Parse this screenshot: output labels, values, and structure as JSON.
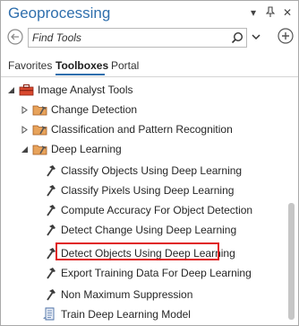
{
  "header": {
    "title": "Geoprocessing"
  },
  "search": {
    "placeholder": "Find Tools"
  },
  "tabs": [
    {
      "label": "Favorites"
    },
    {
      "label": "Toolboxes",
      "active": true
    },
    {
      "label": "Portal"
    }
  ],
  "tree": {
    "toolbox": {
      "label": "Image Analyst Tools",
      "icon": "toolbox-icon",
      "expanded": true
    },
    "toolsets": [
      {
        "label": "Change Detection",
        "icon": "toolset-icon",
        "expanded": false
      },
      {
        "label": "Classification and Pattern Recognition",
        "icon": "toolset-icon",
        "expanded": false
      },
      {
        "label": "Deep Learning",
        "icon": "toolset-icon",
        "expanded": true
      }
    ],
    "tools": [
      {
        "label": "Classify Objects Using Deep Learning",
        "icon": "hammer-icon"
      },
      {
        "label": "Classify Pixels Using Deep Learning",
        "icon": "hammer-icon"
      },
      {
        "label": "Compute Accuracy For Object Detection",
        "icon": "hammer-icon"
      },
      {
        "label": "Detect Change Using Deep Learning",
        "icon": "hammer-icon"
      },
      {
        "label": "Detect Objects Using Deep Learning",
        "icon": "hammer-icon",
        "highlighted": true
      },
      {
        "label": "Export Training Data For Deep Learning",
        "icon": "hammer-icon"
      },
      {
        "label": "Non Maximum Suppression",
        "icon": "hammer-icon"
      },
      {
        "label": "Train Deep Learning Model",
        "icon": "script-icon"
      }
    ]
  },
  "colors": {
    "title": "#2f6fad",
    "highlight": "#e02020",
    "accent": "#2f6fad"
  }
}
